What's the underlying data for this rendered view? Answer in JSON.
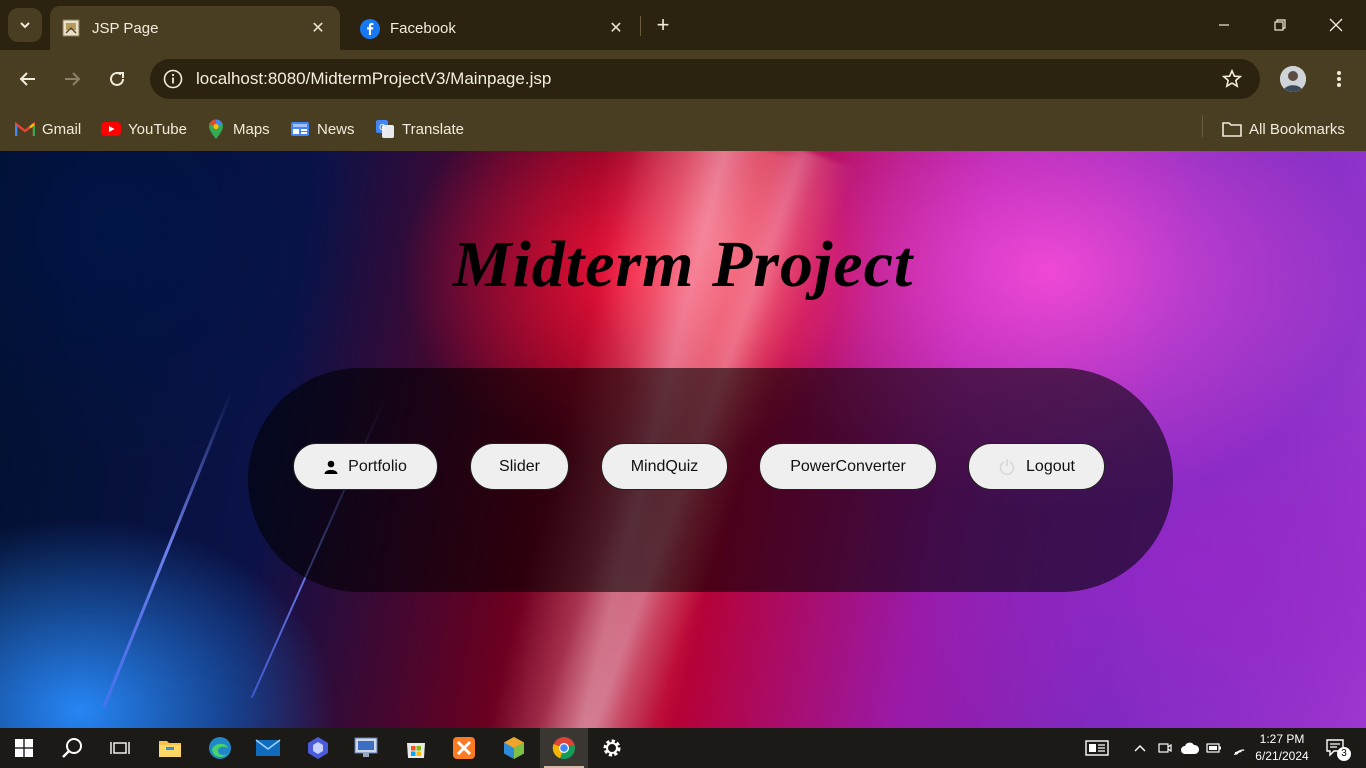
{
  "browser": {
    "tabs": [
      {
        "title": "JSP Page",
        "active": true
      },
      {
        "title": "Facebook",
        "active": false
      }
    ],
    "address": "localhost:8080/MidtermProjectV3/Mainpage.jsp",
    "bookmarks": [
      {
        "label": "Gmail",
        "icon": "gmail-icon"
      },
      {
        "label": "YouTube",
        "icon": "youtube-icon"
      },
      {
        "label": "Maps",
        "icon": "maps-icon"
      },
      {
        "label": "News",
        "icon": "news-icon"
      },
      {
        "label": "Translate",
        "icon": "translate-icon"
      }
    ],
    "all_bookmarks": "All Bookmarks"
  },
  "page": {
    "title": "Midterm Project",
    "nav": [
      {
        "label": "Portfolio",
        "icon": "user-icon"
      },
      {
        "label": "Slider"
      },
      {
        "label": "MindQuiz"
      },
      {
        "label": "PowerConverter"
      },
      {
        "label": "Logout",
        "icon": "logout-icon"
      }
    ]
  },
  "taskbar": {
    "time": "1:27 PM",
    "date": "6/21/2024",
    "notification_count": "3"
  },
  "colors": {
    "chrome_dark": "#2b2310",
    "chrome_light": "#4a3e22",
    "button_bg": "#efefef",
    "taskbar": "#1c1a17"
  }
}
